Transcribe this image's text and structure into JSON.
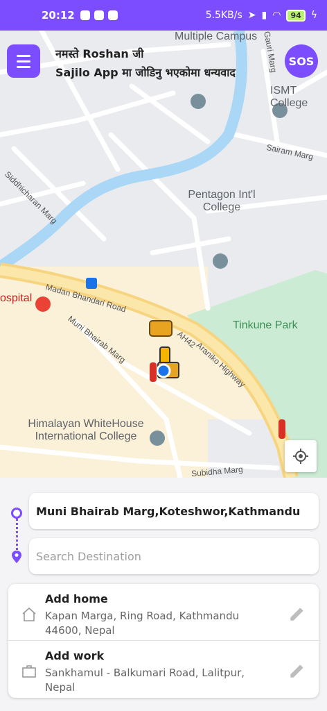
{
  "status_bar": {
    "time": "20:12",
    "network_speed": "5.5KB/s",
    "battery": "94"
  },
  "header": {
    "greeting_line1": "नमस्ते  Roshan जी",
    "greeting_line2": "Sajilo App मा जोडिनु भएकोमा धन्यवाद",
    "sos_label": "SOS",
    "menu_icon": "hamburger-icon"
  },
  "map": {
    "labels": {
      "multiple_campus": "Multiple Campus",
      "ismt_college": "ISMT College",
      "pentagon": "Pentagon Int'l College",
      "tinkune_park": "Tinkune Park",
      "himalayan": "Himalayan WhiteHouse International College",
      "hospital": "ospital"
    },
    "streets": {
      "gauri_marg": "Gauri Marg",
      "sairam_marg": "Sairam Marg",
      "siddhicharan_marg": "Siddhicharan Marg",
      "madan_bhandari": "Madan Bhandari Road",
      "muni_bhairab": "Muni Bhairab Marg",
      "araniko_hwy": "Araniko Highway",
      "road_code": "AH42",
      "subidha_marg": "Subidha Marg"
    },
    "locate_icon": "my-location-icon"
  },
  "route": {
    "origin": "Muni Bhairab Marg,Koteshwor,Kathmandu",
    "destination_placeholder": "Search Destination"
  },
  "saved_places": [
    {
      "title": "Add home",
      "address": "Kapan Marga, Ring Road, Kathmandu 44600, Nepal",
      "icon": "home-icon"
    },
    {
      "title": "Add work",
      "address": "Sankhamul - Balkumari Road, Lalitpur, Nepal",
      "icon": "briefcase-icon"
    }
  ]
}
